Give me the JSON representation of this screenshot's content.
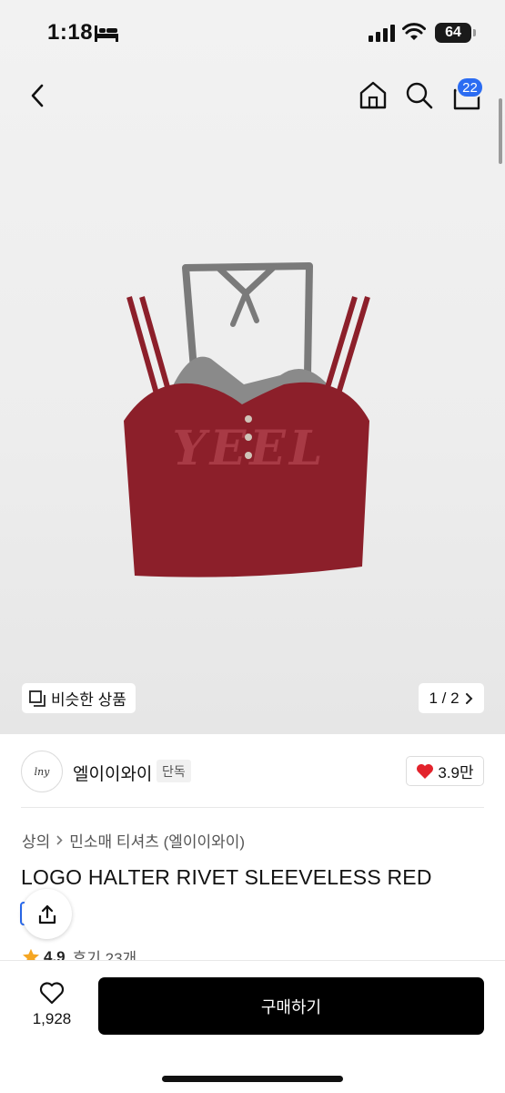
{
  "status": {
    "time": "1:18",
    "battery": "64"
  },
  "nav": {
    "cart_count": "22"
  },
  "gallery": {
    "similar_label": "비슷한 상품",
    "pager": "1 / 2"
  },
  "brand": {
    "logo_text": "lny",
    "name": "엘이이와이",
    "tag": "단독",
    "likes": "3.9만"
  },
  "breadcrumb": [
    "상의",
    "민소매 티셔츠 (엘이이와이)"
  ],
  "product": {
    "title": "LOGO HALTER RIVET SLEEVELESS RED",
    "image_text": "YEEL",
    "rating": "4.9",
    "reviews": "후기 23개"
  },
  "bottom": {
    "wish_count": "1,928",
    "buy_label": "구매하기"
  },
  "colors": {
    "accent": "#2b6cf2",
    "heart": "#e3232c",
    "garment": "#8c1f2a",
    "halter": "#7a7a7a"
  },
  "icons": [
    "bed-icon",
    "signal-icon",
    "wifi-icon",
    "back-icon",
    "home-icon",
    "search-icon",
    "cart-icon",
    "similar-icon",
    "chevron-right-icon",
    "heart-icon",
    "share-icon",
    "star-icon"
  ]
}
